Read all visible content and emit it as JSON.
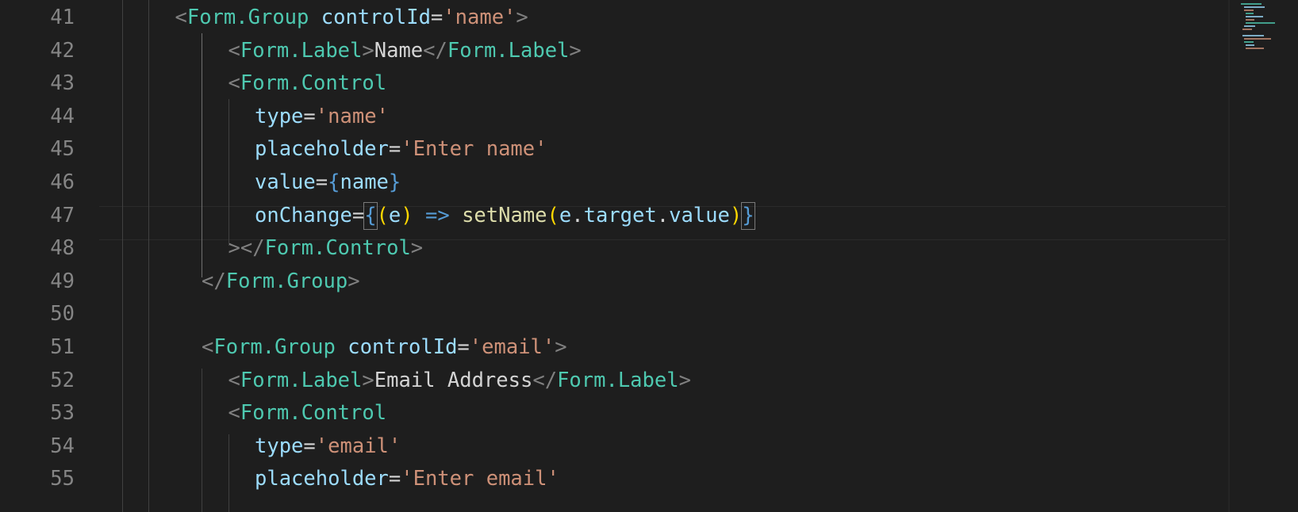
{
  "editor": {
    "language": "javascriptreact",
    "colors": {
      "background": "#1e1e1e",
      "line_number": "#858585",
      "tag": "#4ec9b0",
      "attribute": "#9cdcfe",
      "string": "#ce9178",
      "function": "#dcdcaa",
      "bracket_level_1": "#ffd700",
      "bracket_level_2": "#da70d6"
    },
    "current_line": 47,
    "lines": [
      {
        "number": "41",
        "indent": 3,
        "tokens": [
          [
            "punc",
            "<"
          ],
          [
            "tag",
            "Form.Group"
          ],
          [
            "text",
            " "
          ],
          [
            "attr",
            "controlId"
          ],
          [
            "eq",
            "="
          ],
          [
            "str",
            "'name'"
          ],
          [
            "punc",
            ">"
          ]
        ]
      },
      {
        "number": "42",
        "indent": 5,
        "tokens": [
          [
            "punc",
            "<"
          ],
          [
            "tag",
            "Form.Label"
          ],
          [
            "punc",
            ">"
          ],
          [
            "text",
            "Name"
          ],
          [
            "punc",
            "</"
          ],
          [
            "tag",
            "Form.Label"
          ],
          [
            "punc",
            ">"
          ]
        ]
      },
      {
        "number": "43",
        "indent": 5,
        "tokens": [
          [
            "punc",
            "<"
          ],
          [
            "tag",
            "Form.Control"
          ]
        ]
      },
      {
        "number": "44",
        "indent": 6,
        "tokens": [
          [
            "attr",
            "type"
          ],
          [
            "eq",
            "="
          ],
          [
            "str",
            "'name'"
          ]
        ]
      },
      {
        "number": "45",
        "indent": 6,
        "tokens": [
          [
            "attr",
            "placeholder"
          ],
          [
            "eq",
            "="
          ],
          [
            "str",
            "'Enter name'"
          ]
        ]
      },
      {
        "number": "46",
        "indent": 6,
        "tokens": [
          [
            "attr",
            "value"
          ],
          [
            "eq",
            "="
          ],
          [
            "op",
            "{"
          ],
          [
            "var",
            "name"
          ],
          [
            "op",
            "}"
          ]
        ]
      },
      {
        "number": "47",
        "indent": 6,
        "tokens": [
          [
            "attr",
            "onChange"
          ],
          [
            "eq",
            "="
          ],
          [
            "op",
            "{"
          ],
          [
            "b1",
            "("
          ],
          [
            "var",
            "e"
          ],
          [
            "b1",
            ")"
          ],
          [
            "text",
            " "
          ],
          [
            "op",
            "=>"
          ],
          [
            "text",
            " "
          ],
          [
            "fn",
            "setName"
          ],
          [
            "b1",
            "("
          ],
          [
            "var",
            "e"
          ],
          [
            "text",
            "."
          ],
          [
            "var",
            "target"
          ],
          [
            "text",
            "."
          ],
          [
            "var",
            "value"
          ],
          [
            "b1",
            ")"
          ],
          [
            "op",
            "}"
          ]
        ]
      },
      {
        "number": "48",
        "indent": 5,
        "tokens": [
          [
            "punc",
            "></"
          ],
          [
            "tag",
            "Form.Control"
          ],
          [
            "punc",
            ">"
          ]
        ]
      },
      {
        "number": "49",
        "indent": 4,
        "tokens": [
          [
            "punc",
            "</"
          ],
          [
            "tag",
            "Form.Group"
          ],
          [
            "punc",
            ">"
          ]
        ]
      },
      {
        "number": "50",
        "indent": 0,
        "tokens": []
      },
      {
        "number": "51",
        "indent": 4,
        "tokens": [
          [
            "punc",
            "<"
          ],
          [
            "tag",
            "Form.Group"
          ],
          [
            "text",
            " "
          ],
          [
            "attr",
            "controlId"
          ],
          [
            "eq",
            "="
          ],
          [
            "str",
            "'email'"
          ],
          [
            "punc",
            ">"
          ]
        ]
      },
      {
        "number": "52",
        "indent": 5,
        "tokens": [
          [
            "punc",
            "<"
          ],
          [
            "tag",
            "Form.Label"
          ],
          [
            "punc",
            ">"
          ],
          [
            "text",
            "Email Address"
          ],
          [
            "punc",
            "</"
          ],
          [
            "tag",
            "Form.Label"
          ],
          [
            "punc",
            ">"
          ]
        ]
      },
      {
        "number": "53",
        "indent": 5,
        "tokens": [
          [
            "punc",
            "<"
          ],
          [
            "tag",
            "Form.Control"
          ]
        ]
      },
      {
        "number": "54",
        "indent": 6,
        "tokens": [
          [
            "attr",
            "type"
          ],
          [
            "eq",
            "="
          ],
          [
            "str",
            "'email'"
          ]
        ]
      },
      {
        "number": "55",
        "indent": 6,
        "tokens": [
          [
            "attr",
            "placeholder"
          ],
          [
            "eq",
            "="
          ],
          [
            "str",
            "'Enter email'"
          ]
        ]
      }
    ]
  }
}
